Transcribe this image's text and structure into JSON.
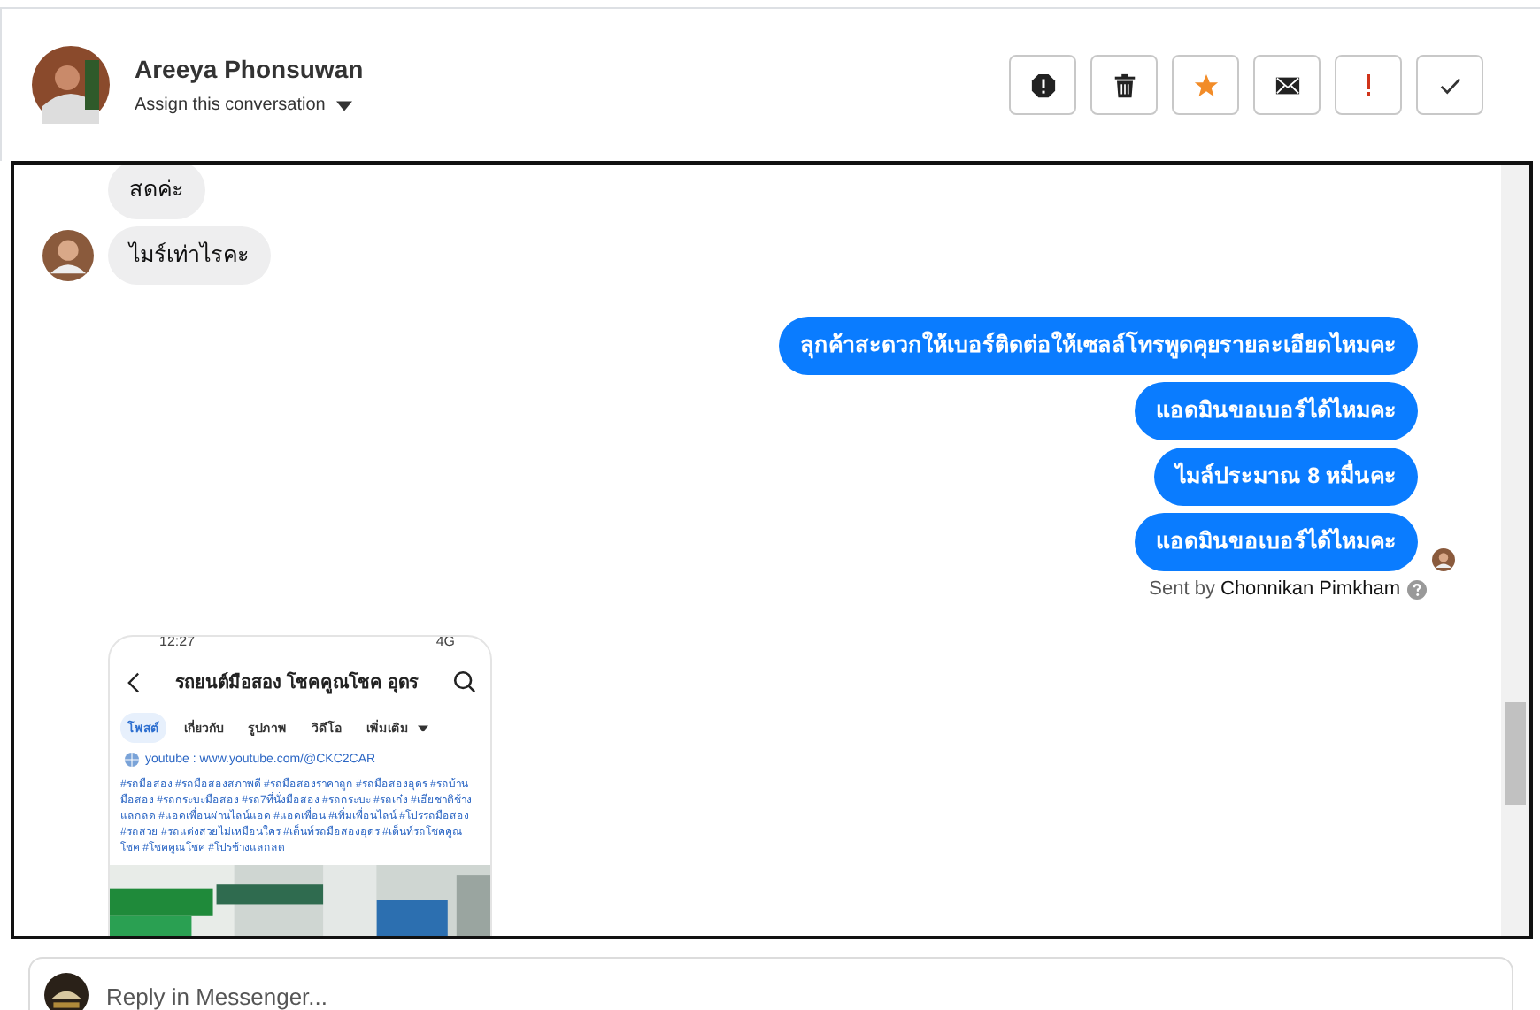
{
  "contact": {
    "name": "Areeya Phonsuwan",
    "assign_label": "Assign this conversation"
  },
  "actions": [
    {
      "kind": "spam"
    },
    {
      "kind": "trash"
    },
    {
      "kind": "star"
    },
    {
      "kind": "mail"
    },
    {
      "kind": "important"
    },
    {
      "kind": "done"
    }
  ],
  "messages": [
    {
      "kind": "incoming",
      "text": "สดค่ะ",
      "avatar": false
    },
    {
      "kind": "incoming",
      "text": "ไมร์เท่าไรคะ",
      "avatar": true
    },
    {
      "kind": "outgoing",
      "text": "ลุกค้าสะดวกให้เบอร์ติดต่อให้เซลล์โทรพูดคุยรายละเอียดไหมคะ",
      "avatar": false
    },
    {
      "kind": "outgoing",
      "text": "แอดมินขอเบอร์ได้ไหมคะ",
      "avatar": false
    },
    {
      "kind": "outgoing",
      "text": "ไมล์ประมาณ 8 หมื่นคะ",
      "avatar": false
    },
    {
      "kind": "outgoing",
      "text": "แอดมินขอเบอร์ได้ไหมคะ",
      "avatar": true
    },
    {
      "kind": "sent_by",
      "text": "Sent by **Chonnikan Pimkham**"
    },
    {
      "kind": "attachment",
      "status_time": "12:27",
      "status_network": "4G",
      "page_title": "รถยนต์มือสอง โชคคูณโชค อุดร",
      "tabs": [
        {
          "label": "โพสต์",
          "selected": true
        },
        {
          "label": "เกี่ยวกับ",
          "selected": false
        },
        {
          "label": "รูปภาพ",
          "selected": false
        },
        {
          "label": "วิดีโอ",
          "selected": false
        },
        {
          "label": "เพิ่มเติม",
          "selected": false
        }
      ],
      "link": "youtube : www.youtube.com/@CKC2CAR",
      "hashtags": "#รถมือสอง #รถมือสองสภาพดี #รถมือสองราคาถูก #รถมือสองอุดร #รถบ้านมือสอง #รถกระบะมือสอง #รถ7ที่นั่งมือสอง #รถกระบะ #รถเก๋ง #เฮียชาติช้างแลกลด #แอดเพื่อนผ่านไลน์แอด #แอดเพื่อน #เพิ่มเพื่อนไลน์ #โปรรถมือสอง #รถสวย #รถแต่งสวยไม่เหมือนใคร #เต็นท์รถมือสองอุดร #เต็นท์รถโชคคูณโชค #โชคคูณโชค #โปรช้างแลกลด"
    }
  ],
  "reply": {
    "placeholder": "Reply in Messenger..."
  }
}
